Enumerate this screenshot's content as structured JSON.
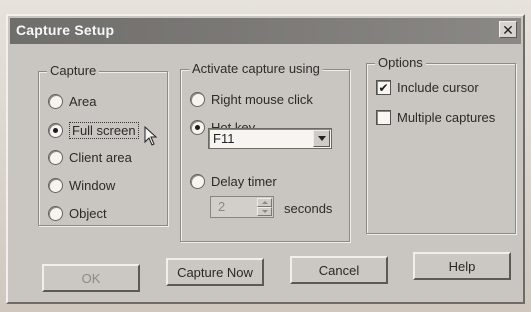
{
  "dialog": {
    "title": "Capture Setup",
    "close_glyph": "✕"
  },
  "capture": {
    "legend": "Capture",
    "options": [
      {
        "label": "Area",
        "selected": false
      },
      {
        "label": "Full screen",
        "selected": true
      },
      {
        "label": "Client area",
        "selected": false
      },
      {
        "label": "Window",
        "selected": false
      },
      {
        "label": "Object",
        "selected": false
      }
    ]
  },
  "activate": {
    "legend": "Activate capture using",
    "options": [
      {
        "label": "Right mouse click",
        "selected": false
      },
      {
        "label": "Hot key",
        "selected": true
      },
      {
        "label": "Delay timer",
        "selected": false
      }
    ],
    "hotkey_value": "F11",
    "delay_value": "2",
    "delay_unit": "seconds"
  },
  "options": {
    "legend": "Options",
    "items": [
      {
        "label": "Include cursor",
        "checked": true,
        "mark": "✔"
      },
      {
        "label": "Multiple captures",
        "checked": false,
        "mark": ""
      }
    ]
  },
  "buttons": {
    "ok": "OK",
    "capture_now": "Capture Now",
    "cancel": "Cancel",
    "help": "Help"
  },
  "icons": {
    "close": "close-icon",
    "dropdown": "chevron-down-icon",
    "spin_up": "spin-up-icon",
    "spin_down": "spin-down-icon",
    "cursor": "mouse-pointer-icon"
  }
}
